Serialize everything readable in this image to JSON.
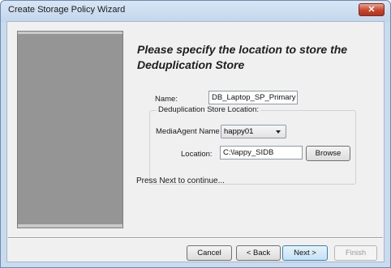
{
  "window": {
    "title": "Create Storage Policy Wizard",
    "close_glyph": "✕"
  },
  "heading": "Please specify the location to store the Deduplication Store",
  "form": {
    "name_label": "Name:",
    "name_value": "DB_Laptop_SP_Primary",
    "group_label": "Deduplication Store Location:",
    "media_agent_label": "MediaAgent Name",
    "media_agent_value": "happy01",
    "location_label": "Location:",
    "location_value": "C:\\lappy_SIDB",
    "browse_label": "Browse"
  },
  "hint": "Press Next to continue...",
  "footer": {
    "cancel": "Cancel",
    "back": "< Back",
    "next": "Next >",
    "finish": "Finish"
  }
}
